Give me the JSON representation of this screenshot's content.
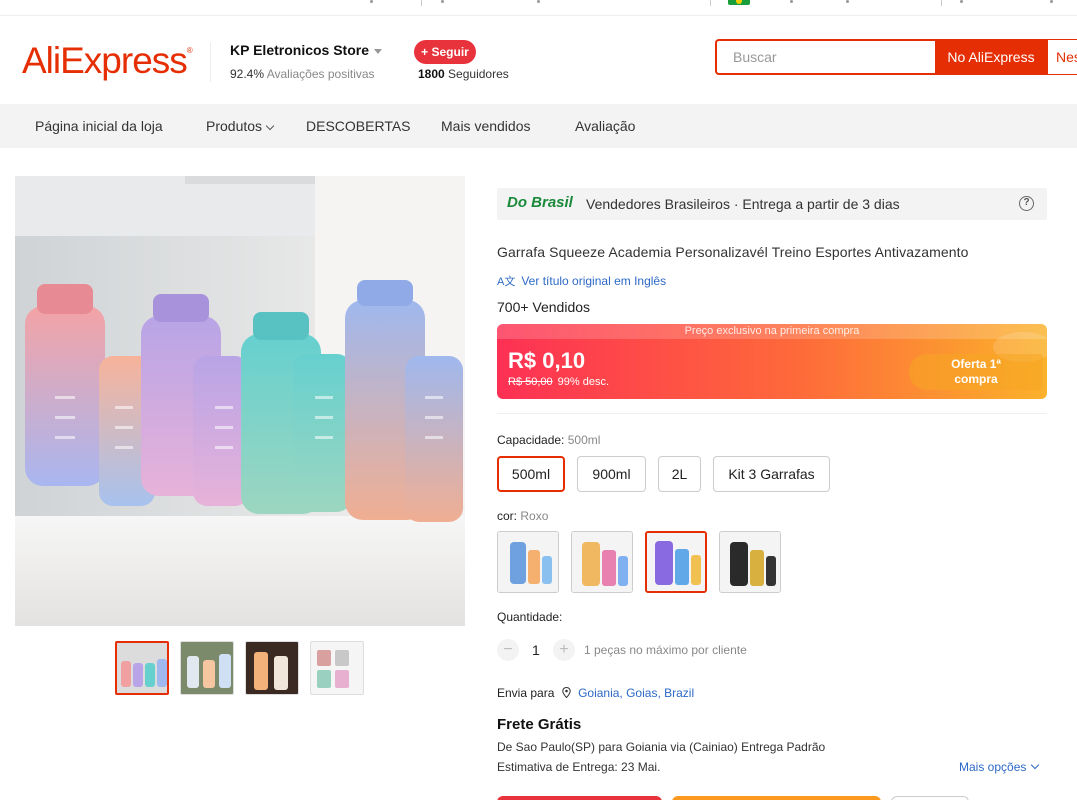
{
  "header": {
    "logo": "AliExpress",
    "store_name": "KP Eletronicos Store",
    "rating_pct": "92.4%",
    "rating_label": "Avaliações positivas",
    "follow_label": "+ Seguir",
    "followers_count": "1800",
    "followers_label": "Seguidores",
    "search_placeholder": "Buscar",
    "search_button": "No AliExpress",
    "search_button2": "Nesta loja"
  },
  "nav": {
    "items": [
      "Página inicial da loja",
      "Produtos",
      "DESCOBERTAS",
      "Mais vendidos",
      "Avaliação"
    ]
  },
  "product": {
    "badge_tag": "Do Brasil",
    "badge_text": "Vendedores Brasileiros · Entrega a partir de 3 dias",
    "help_icon": "?",
    "title": "Garrafa Squeeze Academia Personalizavél Treino Esportes Antivazamento",
    "translate_icon": "A文",
    "translate_link": "Ver título original em Inglês",
    "sold": "700+ Vendidos",
    "price_strip": "Preço exclusivo na primeira compra",
    "price": "R$ 0,10",
    "old_price": "R$ 50,00",
    "discount": "99% desc.",
    "offer_line1": "Oferta 1ª",
    "offer_line2": "compra",
    "capacity_label": "Capacidade:",
    "capacity_value": "500ml",
    "capacity_options": [
      "500ml",
      "900ml",
      "2L",
      "Kit 3 Garrafas"
    ],
    "color_label": "cor:",
    "color_value": "Roxo",
    "quantity_label": "Quantidade:",
    "quantity_minus": "−",
    "quantity_plus": "+",
    "quantity": "1",
    "quantity_note": "1 peças no máximo por cliente",
    "ship_to_label": "Envia para",
    "ship_to_location": "Goiania, Goias, Brazil",
    "shipping_title": "Frete Grátis",
    "route": "De Sao Paulo(SP) para Goiania via (Cainiao) Entrega Padrão",
    "eta": "Estimativa de Entrega: 23 Mai.",
    "more_options": "Mais opções"
  },
  "colors": {
    "brand": "#e62e04",
    "link": "#2d69c6",
    "do_brasil_green": "#1a8a3a"
  }
}
